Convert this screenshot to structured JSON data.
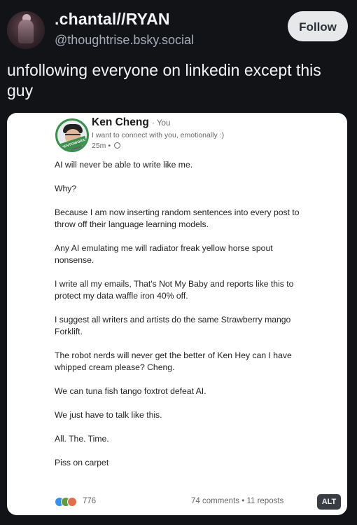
{
  "header": {
    "display_name": ".chantal//RYAN",
    "handle": "@thoughtrise.bsky.social",
    "follow_label": "Follow"
  },
  "post": {
    "text": "unfollowing everyone on linkedin except this guy"
  },
  "embed": {
    "name": "Ken Cheng",
    "you_tag": "· You",
    "headline": "I want to connect with you, emotionally :)",
    "time": "25m •",
    "avatar_badge": "OPENTOWORK",
    "paragraphs": [
      "AI will never be able to write like me.",
      "Why?",
      "Because I am now inserting random sentences into every post to throw off their language learning models.",
      "Any AI emulating me will radiator freak yellow horse spout nonsense.",
      "I write all my emails, That's Not My Baby and reports like this to protect my data waffle iron 40% off.",
      "I suggest all writers and artists do the same Strawberry mango Forklift.",
      "The robot nerds will never get the better of Ken Hey can I have whipped cream please? Cheng.",
      "We can tuna fish tango foxtrot defeat AI.",
      "We just have to talk like this.",
      "All. The. Time.",
      "Piss on carpet"
    ],
    "reaction_count": "776",
    "comments_reposts": "74 comments • 11 reposts"
  },
  "alt_label": "ALT",
  "colors": {
    "background": "#111317",
    "follow_button": "#e7e8ea",
    "linkedin_green": "#3c8f4c"
  }
}
